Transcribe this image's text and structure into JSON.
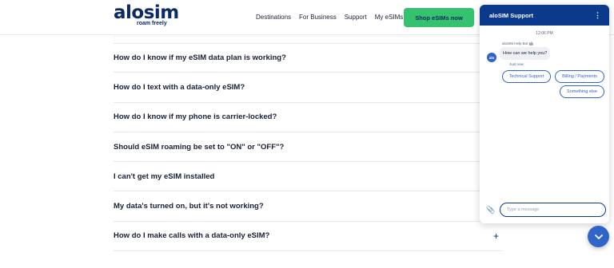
{
  "header": {
    "logo_word": "alosim",
    "logo_sub": "roam freely",
    "nav": [
      "Destinations",
      "For Business",
      "Support",
      "My eSIMs"
    ],
    "shop_label": "Shop eSIMs now"
  },
  "faq": [
    {
      "q": "How do I know if my eSIM data plan is working?",
      "icon": ""
    },
    {
      "q": "How do I text with a data-only eSIM?",
      "icon": ""
    },
    {
      "q": "How do I know if my phone is carrier-locked?",
      "icon": ""
    },
    {
      "q": "Should eSIM roaming be set to \"ON\" or \"OFF\"?",
      "icon": ""
    },
    {
      "q": "I can't get my eSIM installed",
      "icon": ""
    },
    {
      "q": "My data's turned on, but it's not working?",
      "icon": ""
    },
    {
      "q": "How do I make calls with a data-only eSIM?",
      "icon": "+"
    }
  ],
  "chat": {
    "title": "aloSIM Support",
    "menu": "⋮",
    "time": "12:06 PM",
    "bot_name": "aloSIM Help Bot 🤖",
    "avatar": "alo",
    "greeting": "How can we help you?",
    "just_now": "Just now",
    "options": [
      "Technical Support",
      "Billing / Payments",
      "Something else"
    ],
    "placeholder": "Type a message",
    "clip": "📎"
  },
  "fab_icon": "chevron-down-icon"
}
